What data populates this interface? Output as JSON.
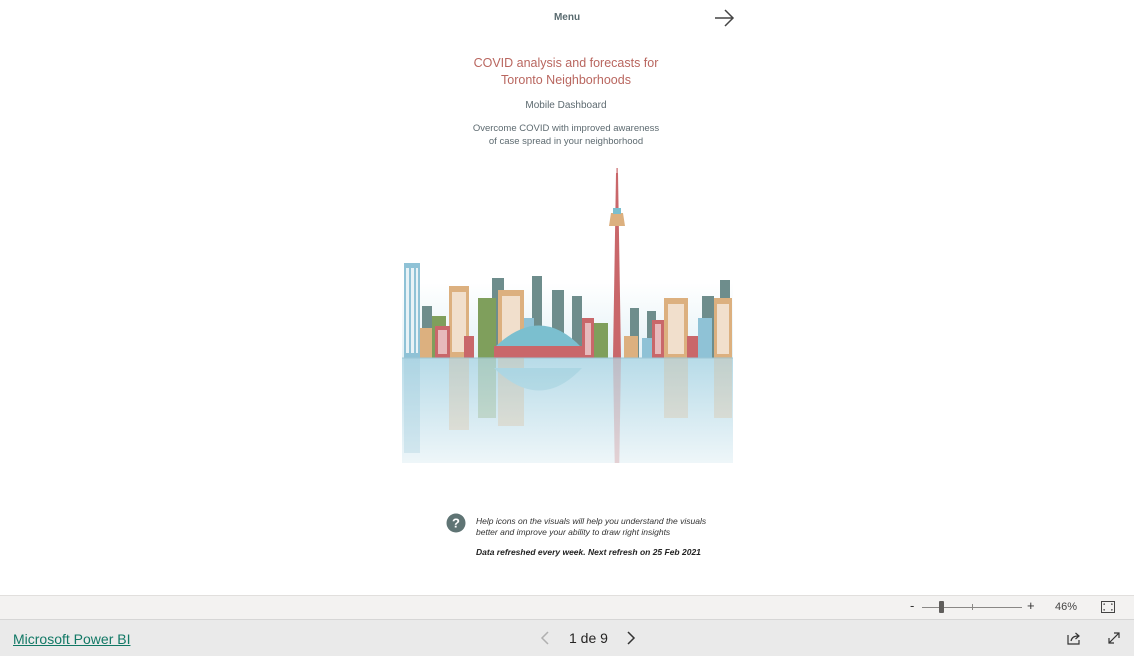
{
  "report": {
    "menu_label": "Menu",
    "title_line1": "COVID analysis and forecasts for",
    "title_line2": "Toronto Neighborhoods",
    "subtitle": "Mobile Dashboard",
    "tagline_line1": "Overcome COVID with improved awareness",
    "tagline_line2": "of case spread in your neighborhood",
    "help_line1": "Help icons on the visuals will help you understand the visuals",
    "help_line2": "better and improve your ability to draw right insights",
    "refresh_note": "Data refreshed every week. Next refresh on 25 Feb 2021",
    "colors": {
      "title": "#b9665f",
      "tower": "#c9675f",
      "water": "#bfe0ea",
      "building_blue": "#8fc2d6",
      "building_gray": "#6e8d8c",
      "building_tan": "#dcb07f",
      "building_green": "#7f9f5c",
      "building_red": "#c9676a"
    },
    "icons": [
      "arrow-right-icon",
      "help-icon"
    ]
  },
  "zoom": {
    "minus_label": "-",
    "plus_label": "+",
    "percent": "46%",
    "level": 0.46
  },
  "footer": {
    "brand_link": "Microsoft Power BI",
    "page_indicator": "1 de 9",
    "icons": [
      "chevron-left-icon",
      "chevron-right-icon",
      "share-icon",
      "fullscreen-icon",
      "fit-page-icon"
    ]
  }
}
